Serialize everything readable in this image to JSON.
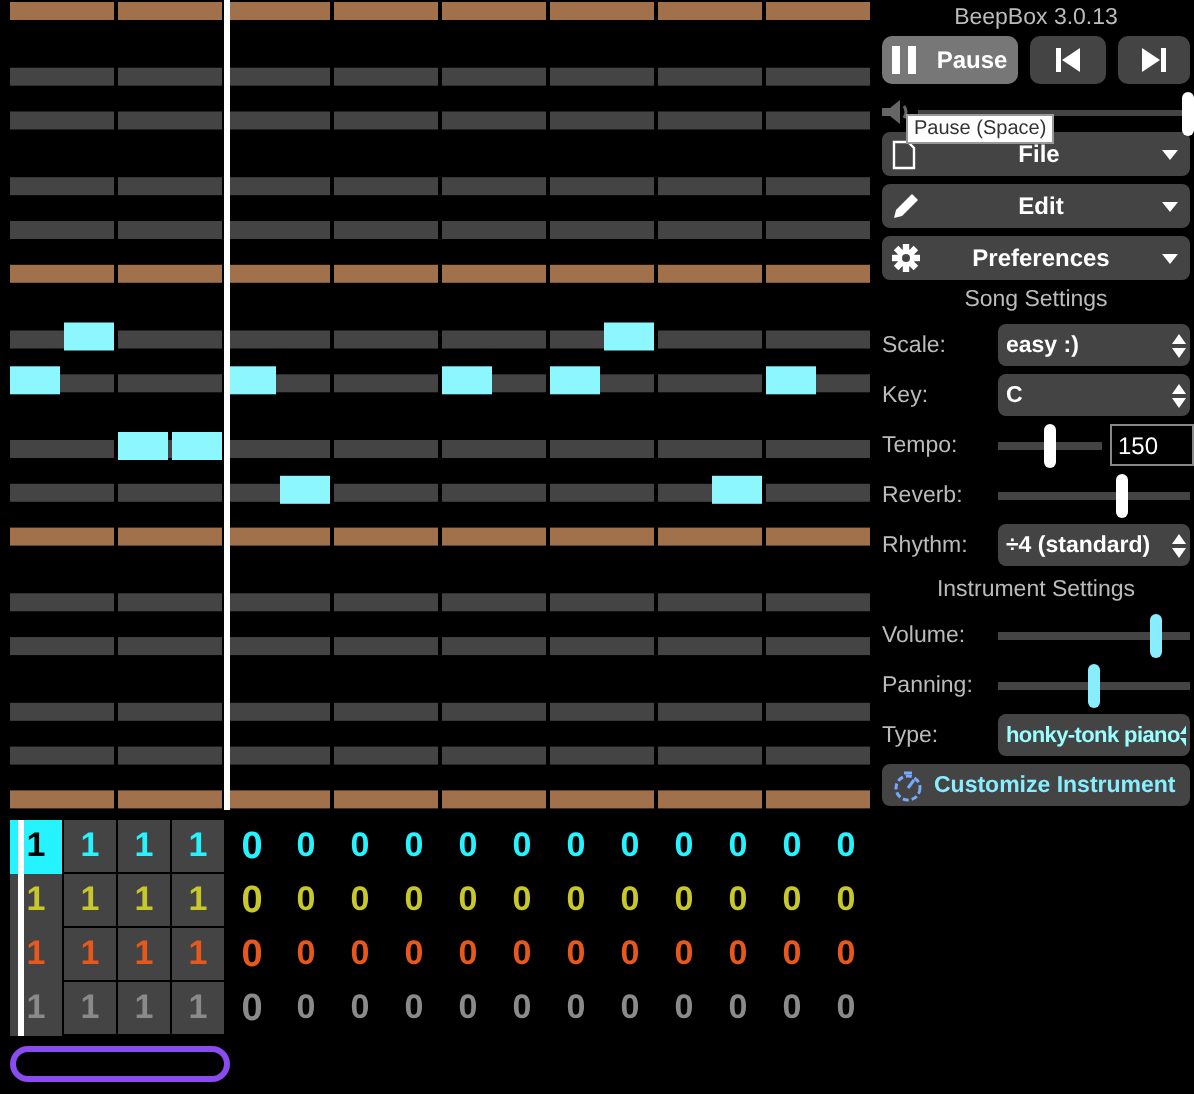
{
  "pattern": {
    "channels": [
      {
        "color": "#25f3ff",
        "cells": [
          {
            "text": "1",
            "selected": true
          },
          {
            "text": "1",
            "selected": false
          },
          {
            "text": "1",
            "selected": false
          },
          {
            "text": "1",
            "selected": false
          },
          {
            "text": "0",
            "selected": false
          },
          {
            "text": "0",
            "selected": false
          },
          {
            "text": "0",
            "selected": false
          },
          {
            "text": "0",
            "selected": false
          },
          {
            "text": "0",
            "selected": false
          },
          {
            "text": "0",
            "selected": false
          },
          {
            "text": "0",
            "selected": false
          },
          {
            "text": "0",
            "selected": false
          },
          {
            "text": "0",
            "selected": false
          },
          {
            "text": "0",
            "selected": false
          },
          {
            "text": "0",
            "selected": false
          },
          {
            "text": "0",
            "selected": false
          }
        ]
      },
      {
        "color": "#c8c82c",
        "cells": [
          {
            "text": "1",
            "selected": false
          },
          {
            "text": "1",
            "selected": false
          },
          {
            "text": "1",
            "selected": false
          },
          {
            "text": "1",
            "selected": false
          },
          {
            "text": "0",
            "selected": false
          },
          {
            "text": "0",
            "selected": false
          },
          {
            "text": "0",
            "selected": false
          },
          {
            "text": "0",
            "selected": false
          },
          {
            "text": "0",
            "selected": false
          },
          {
            "text": "0",
            "selected": false
          },
          {
            "text": "0",
            "selected": false
          },
          {
            "text": "0",
            "selected": false
          },
          {
            "text": "0",
            "selected": false
          },
          {
            "text": "0",
            "selected": false
          },
          {
            "text": "0",
            "selected": false
          },
          {
            "text": "0",
            "selected": false
          }
        ]
      },
      {
        "color": "#e8581c",
        "cells": [
          {
            "text": "1",
            "selected": false
          },
          {
            "text": "1",
            "selected": false
          },
          {
            "text": "1",
            "selected": false
          },
          {
            "text": "1",
            "selected": false
          },
          {
            "text": "0",
            "selected": false
          },
          {
            "text": "0",
            "selected": false
          },
          {
            "text": "0",
            "selected": false
          },
          {
            "text": "0",
            "selected": false
          },
          {
            "text": "0",
            "selected": false
          },
          {
            "text": "0",
            "selected": false
          },
          {
            "text": "0",
            "selected": false
          },
          {
            "text": "0",
            "selected": false
          },
          {
            "text": "0",
            "selected": false
          },
          {
            "text": "0",
            "selected": false
          },
          {
            "text": "0",
            "selected": false
          },
          {
            "text": "0",
            "selected": false
          }
        ]
      },
      {
        "color": "#8a8a8a",
        "cells": [
          {
            "text": "1",
            "selected": false
          },
          {
            "text": "1",
            "selected": false
          },
          {
            "text": "1",
            "selected": false
          },
          {
            "text": "1",
            "selected": false
          },
          {
            "text": "0",
            "selected": false
          },
          {
            "text": "0",
            "selected": false
          },
          {
            "text": "0",
            "selected": false
          },
          {
            "text": "0",
            "selected": false
          },
          {
            "text": "0",
            "selected": false
          },
          {
            "text": "0",
            "selected": false
          },
          {
            "text": "0",
            "selected": false
          },
          {
            "text": "0",
            "selected": false
          },
          {
            "text": "0",
            "selected": false
          },
          {
            "text": "0",
            "selected": false
          },
          {
            "text": "0",
            "selected": false
          },
          {
            "text": "0",
            "selected": false
          }
        ]
      }
    ]
  },
  "panel": {
    "title": "BeepBox 3.0.13",
    "transport": [
      {
        "kind": "play",
        "label": "Pause"
      },
      {
        "kind": "prev"
      },
      {
        "kind": "next"
      }
    ],
    "volume": {
      "level": 1.0
    },
    "tooltip": "Pause (Space)",
    "menus": [
      {
        "kind": "file",
        "label": "File"
      },
      {
        "kind": "edit",
        "label": "Edit"
      },
      {
        "kind": "prefs",
        "label": "Preferences"
      }
    ],
    "song_heading": "Song Settings",
    "song_rows": [
      {
        "kind": "select",
        "label": "Scale:",
        "value": "easy :)"
      },
      {
        "kind": "select",
        "label": "Key:",
        "value": "C"
      },
      {
        "kind": "slider_field",
        "label": "Tempo:",
        "level": 0.5,
        "value": "150"
      },
      {
        "kind": "slider",
        "label": "Reverb:",
        "level": 0.65
      },
      {
        "kind": "select",
        "label": "Rhythm:",
        "value": "÷4 (standard)"
      }
    ],
    "instrument_heading": "Instrument Settings",
    "instrument_rows": [
      {
        "kind": "slider",
        "label": "Volume:",
        "level": 0.82,
        "accent": true
      },
      {
        "kind": "slider",
        "label": "Panning:",
        "level": 0.5,
        "accent": true
      },
      {
        "kind": "select",
        "label": "Type:",
        "value": "honky-tonk piano",
        "accent": true
      }
    ],
    "customize": "Customize Instrument"
  }
}
